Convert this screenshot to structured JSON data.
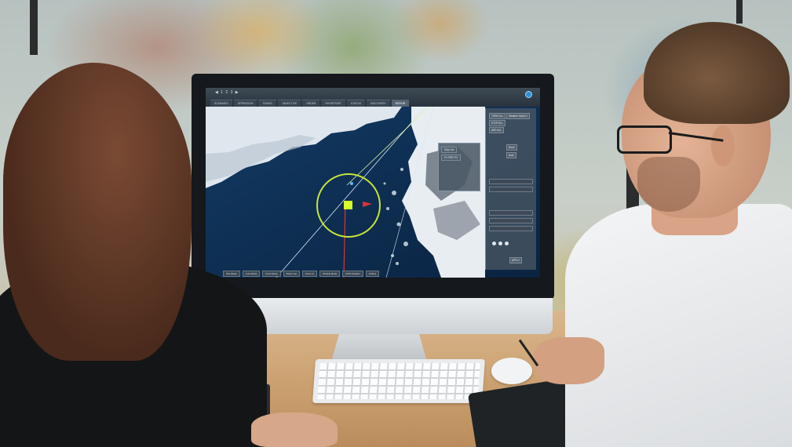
{
  "scene": {
    "description_colors": {
      "screen_ocean": "#0d2a4a",
      "target_circle": "#c8e63a",
      "track_line": "#e0303a",
      "app_header": "#2a333c"
    }
  },
  "app": {
    "pager": "◀ 1 2 3 ▶",
    "tabs": [
      {
        "label": "SCENARIO"
      },
      {
        "label": "OPERATION"
      },
      {
        "label": "TRAVEL"
      },
      {
        "label": "OBJECTIVE"
      },
      {
        "label": "ORDER"
      },
      {
        "label": "FIN REPORT"
      },
      {
        "label": "STATUS"
      },
      {
        "label": "DISCOVERY"
      },
      {
        "label": "REPAIR"
      }
    ],
    "active_tab_index": 8,
    "logo_icon": "app-logo-icon"
  },
  "panel": {
    "buttons": [
      "TURN ALL",
      "STOP ALL",
      "ADD ALL"
    ],
    "dropdown_label": "Weather Model 2",
    "dropdowns": [
      "None",
      "Auto"
    ],
    "action": "APPLY"
  },
  "float_window": {
    "title": "Ship List",
    "selected": "FV PRE PO"
  },
  "bottom_bar": {
    "buttons": [
      "Pan Mode",
      "Lock Mode",
      "Point Mode",
      "Draw Line",
      "Zoom In",
      "SCALE Mode",
      "UNIT Position",
      "Outline"
    ]
  }
}
